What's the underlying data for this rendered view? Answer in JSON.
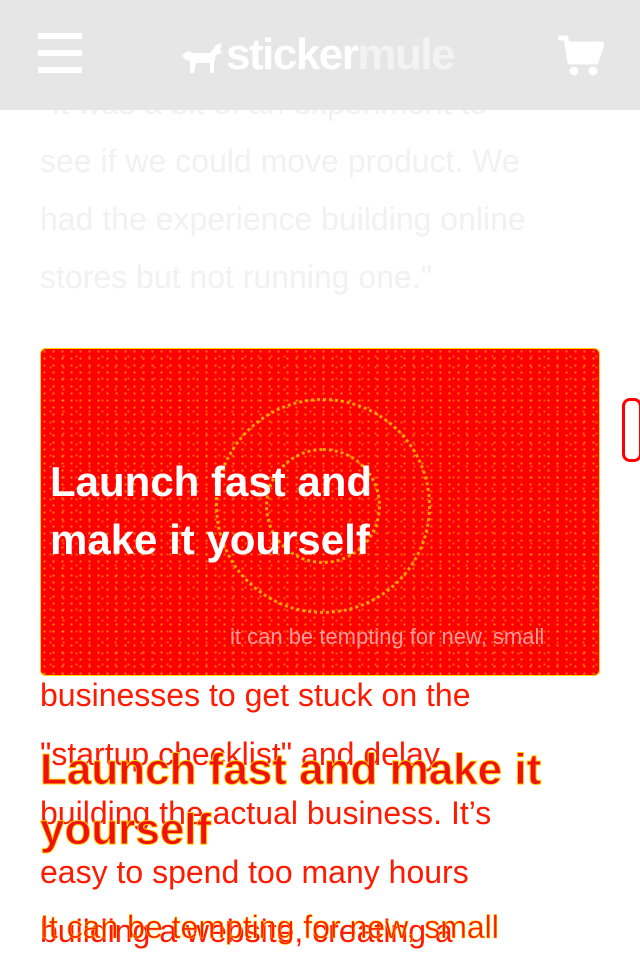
{
  "header": {
    "brand_first": "sticker",
    "brand_second": "mule",
    "menu_icon": "hamburger-menu-icon",
    "cart_icon": "shopping-cart-icon",
    "logo_icon": "mule-logo-icon"
  },
  "quote": {
    "lines": [
      "\"It was a bit of an experiment to",
      "see if we could move product. We",
      "had the experience building online",
      "stores but not running one.\""
    ]
  },
  "hero": {
    "title_line1": "Launch fast and",
    "title_line2": "make it yourself",
    "caption": "it can be tempting for new, small",
    "color": "#fe0000"
  },
  "body": {
    "lines": [
      "businesses to get stuck on the",
      "\"startup checklist\" and delay",
      "building the actual business. It’s",
      "easy to spend too many hours",
      "building a website, creating a"
    ]
  },
  "section": {
    "heading": "Launch fast and make it yourself",
    "lead": "It can be tempting for new, small"
  },
  "colors": {
    "header_bg": "#e6e6e6",
    "accent_red": "#ff0000",
    "highlight_yellow": "#ffd400"
  }
}
